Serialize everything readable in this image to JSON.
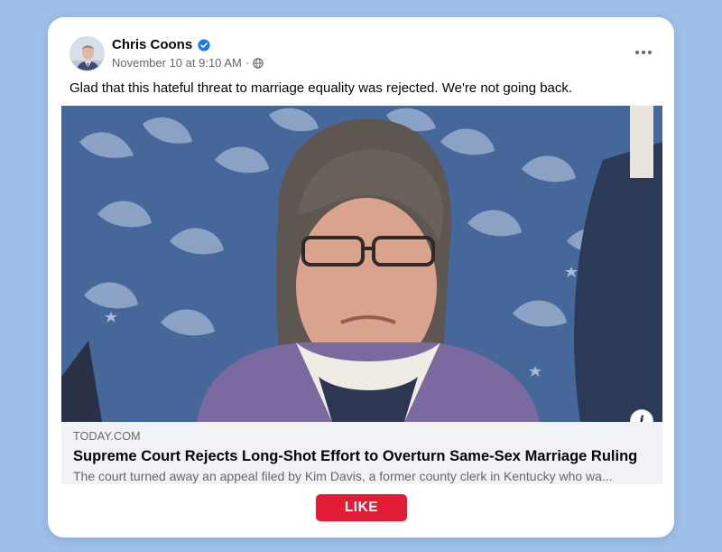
{
  "post": {
    "author": "Chris Coons",
    "timestamp": "November 10 at 9:10 AM",
    "separator": "·",
    "verified_icon": "verified-badge-icon",
    "privacy_icon": "globe-icon",
    "menu_icon": "more-options-icon",
    "text": "Glad that this hateful threat to marriage equality was rejected. We're not going back."
  },
  "link": {
    "domain": "TODAY.COM",
    "headline": "Supreme Court Rejects Long-Shot Effort to Overturn Same-Sex Marriage Ruling",
    "description": "The court turned away an appeal filed by Kim Davis, a former county clerk in Kentucky who wa...",
    "info_label": "i",
    "info_icon": "info-icon"
  },
  "cta": {
    "label": "LIKE"
  },
  "colors": {
    "background": "#9dbfe8",
    "card": "#ffffff",
    "verified": "#1877f2",
    "like_button": "#e01c37",
    "link_meta_bg": "#f0f2f5"
  }
}
